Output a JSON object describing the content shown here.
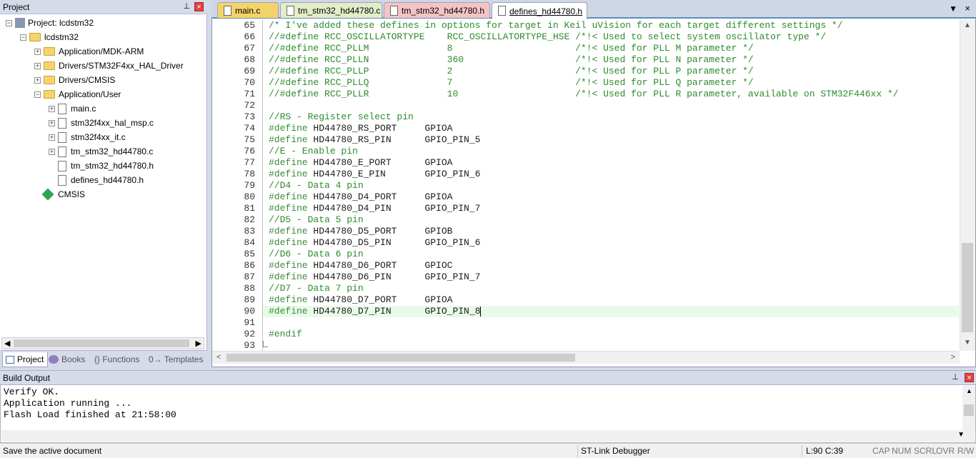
{
  "project_panel": {
    "title": "Project",
    "tree": [
      {
        "label": "Project: lcdstm32",
        "indent": 0,
        "kind": "root",
        "expander": "−"
      },
      {
        "label": "lcdstm32",
        "indent": 1,
        "kind": "target",
        "expander": "−"
      },
      {
        "label": "Application/MDK-ARM",
        "indent": 2,
        "kind": "folder",
        "expander": "+"
      },
      {
        "label": "Drivers/STM32F4xx_HAL_Driver",
        "indent": 2,
        "kind": "folder",
        "expander": "+"
      },
      {
        "label": "Drivers/CMSIS",
        "indent": 2,
        "kind": "folder",
        "expander": "+"
      },
      {
        "label": "Application/User",
        "indent": 2,
        "kind": "folder",
        "expander": "−"
      },
      {
        "label": "main.c",
        "indent": 3,
        "kind": "file",
        "expander": "+"
      },
      {
        "label": "stm32f4xx_hal_msp.c",
        "indent": 3,
        "kind": "file",
        "expander": "+"
      },
      {
        "label": "stm32f4xx_it.c",
        "indent": 3,
        "kind": "file",
        "expander": "+"
      },
      {
        "label": "tm_stm32_hd44780.c",
        "indent": 3,
        "kind": "file",
        "expander": "+"
      },
      {
        "label": "tm_stm32_hd44780.h",
        "indent": 3,
        "kind": "file",
        "expander": ""
      },
      {
        "label": "defines_hd44780.h",
        "indent": 3,
        "kind": "file",
        "expander": ""
      },
      {
        "label": "CMSIS",
        "indent": 2,
        "kind": "cmsis",
        "expander": ""
      }
    ],
    "tabs": [
      "Project",
      "Books",
      "{} Functions",
      "0→ Templates"
    ]
  },
  "editor": {
    "tabs": [
      {
        "label": "main.c",
        "color": "#f5d36a",
        "active": false
      },
      {
        "label": "tm_stm32_hd44780.c",
        "color": "#e3edc8",
        "active": false
      },
      {
        "label": "tm_stm32_hd44780.h",
        "color": "#f4c4c4",
        "active": false
      },
      {
        "label": "defines_hd44780.h",
        "color": "#ffffff",
        "active": true
      }
    ],
    "lines": [
      {
        "n": "65",
        "cls": "cm",
        "text": "/* I've added these defines in options for target in Keil uVision for each target different settings */"
      },
      {
        "n": "66",
        "cls": "cm",
        "text": "//#define RCC_OSCILLATORTYPE    RCC_OSCILLATORTYPE_HSE /*!< Used to select system oscillator type */"
      },
      {
        "n": "67",
        "cls": "cm",
        "text": "//#define RCC_PLLM              8                      /*!< Used for PLL M parameter */"
      },
      {
        "n": "68",
        "cls": "cm",
        "text": "//#define RCC_PLLN              360                    /*!< Used for PLL N parameter */"
      },
      {
        "n": "69",
        "cls": "cm",
        "text": "//#define RCC_PLLP              2                      /*!< Used for PLL P parameter */"
      },
      {
        "n": "70",
        "cls": "cm",
        "text": "//#define RCC_PLLQ              7                      /*!< Used for PLL Q parameter */"
      },
      {
        "n": "71",
        "cls": "cm",
        "text": "//#define RCC_PLLR              10                     /*!< Used for PLL R parameter, available on STM32F446xx */"
      },
      {
        "n": "72",
        "cls": "tx",
        "text": ""
      },
      {
        "n": "73",
        "cls": "cm",
        "text": "//RS - Register select pin"
      },
      {
        "n": "74",
        "cls": "pp",
        "text": "#define",
        "rest": " HD44780_RS_PORT     GPIOA"
      },
      {
        "n": "75",
        "cls": "pp",
        "text": "#define",
        "rest": " HD44780_RS_PIN      GPIO_PIN_5"
      },
      {
        "n": "76",
        "cls": "cm",
        "text": "//E - Enable pin"
      },
      {
        "n": "77",
        "cls": "pp",
        "text": "#define",
        "rest": " HD44780_E_PORT      GPIOA"
      },
      {
        "n": "78",
        "cls": "pp",
        "text": "#define",
        "rest": " HD44780_E_PIN       GPIO_PIN_6"
      },
      {
        "n": "79",
        "cls": "cm",
        "text": "//D4 - Data 4 pin"
      },
      {
        "n": "80",
        "cls": "pp",
        "text": "#define",
        "rest": " HD44780_D4_PORT     GPIOA"
      },
      {
        "n": "81",
        "cls": "pp",
        "text": "#define",
        "rest": " HD44780_D4_PIN      GPIO_PIN_7"
      },
      {
        "n": "82",
        "cls": "cm",
        "text": "//D5 - Data 5 pin"
      },
      {
        "n": "83",
        "cls": "pp",
        "text": "#define",
        "rest": " HD44780_D5_PORT     GPIOB"
      },
      {
        "n": "84",
        "cls": "pp",
        "text": "#define",
        "rest": " HD44780_D5_PIN      GPIO_PIN_6"
      },
      {
        "n": "85",
        "cls": "cm",
        "text": "//D6 - Data 6 pin"
      },
      {
        "n": "86",
        "cls": "pp",
        "text": "#define",
        "rest": " HD44780_D6_PORT     GPIOC"
      },
      {
        "n": "87",
        "cls": "pp",
        "text": "#define",
        "rest": " HD44780_D6_PIN      GPIO_PIN_7"
      },
      {
        "n": "88",
        "cls": "cm",
        "text": "//D7 - Data 7 pin"
      },
      {
        "n": "89",
        "cls": "pp",
        "text": "#define",
        "rest": " HD44780_D7_PORT     GPIOA"
      },
      {
        "n": "90",
        "cls": "pp",
        "text": "#define",
        "rest": " HD44780_D7_PIN      GPIO_PIN_8",
        "current": true
      },
      {
        "n": "91",
        "cls": "tx",
        "text": ""
      },
      {
        "n": "92",
        "cls": "pp",
        "text": "#endif"
      },
      {
        "n": "93",
        "cls": "tx",
        "text": ""
      }
    ]
  },
  "build_output": {
    "title": "Build Output",
    "lines": [
      "Verify OK.",
      "Application running ...",
      "Flash Load finished at 21:58:00"
    ]
  },
  "status_bar": {
    "message": "Save the active document",
    "debugger": "ST-Link Debugger",
    "position": "L:90 C:39",
    "indicators": [
      "CAP",
      "NUM",
      "SCRL",
      "OVR",
      "R/W"
    ]
  },
  "colors": {
    "comment": "#2b8b2b",
    "current_line": "#e8fbe8",
    "active_tab_underline": "#5c8ebd"
  }
}
